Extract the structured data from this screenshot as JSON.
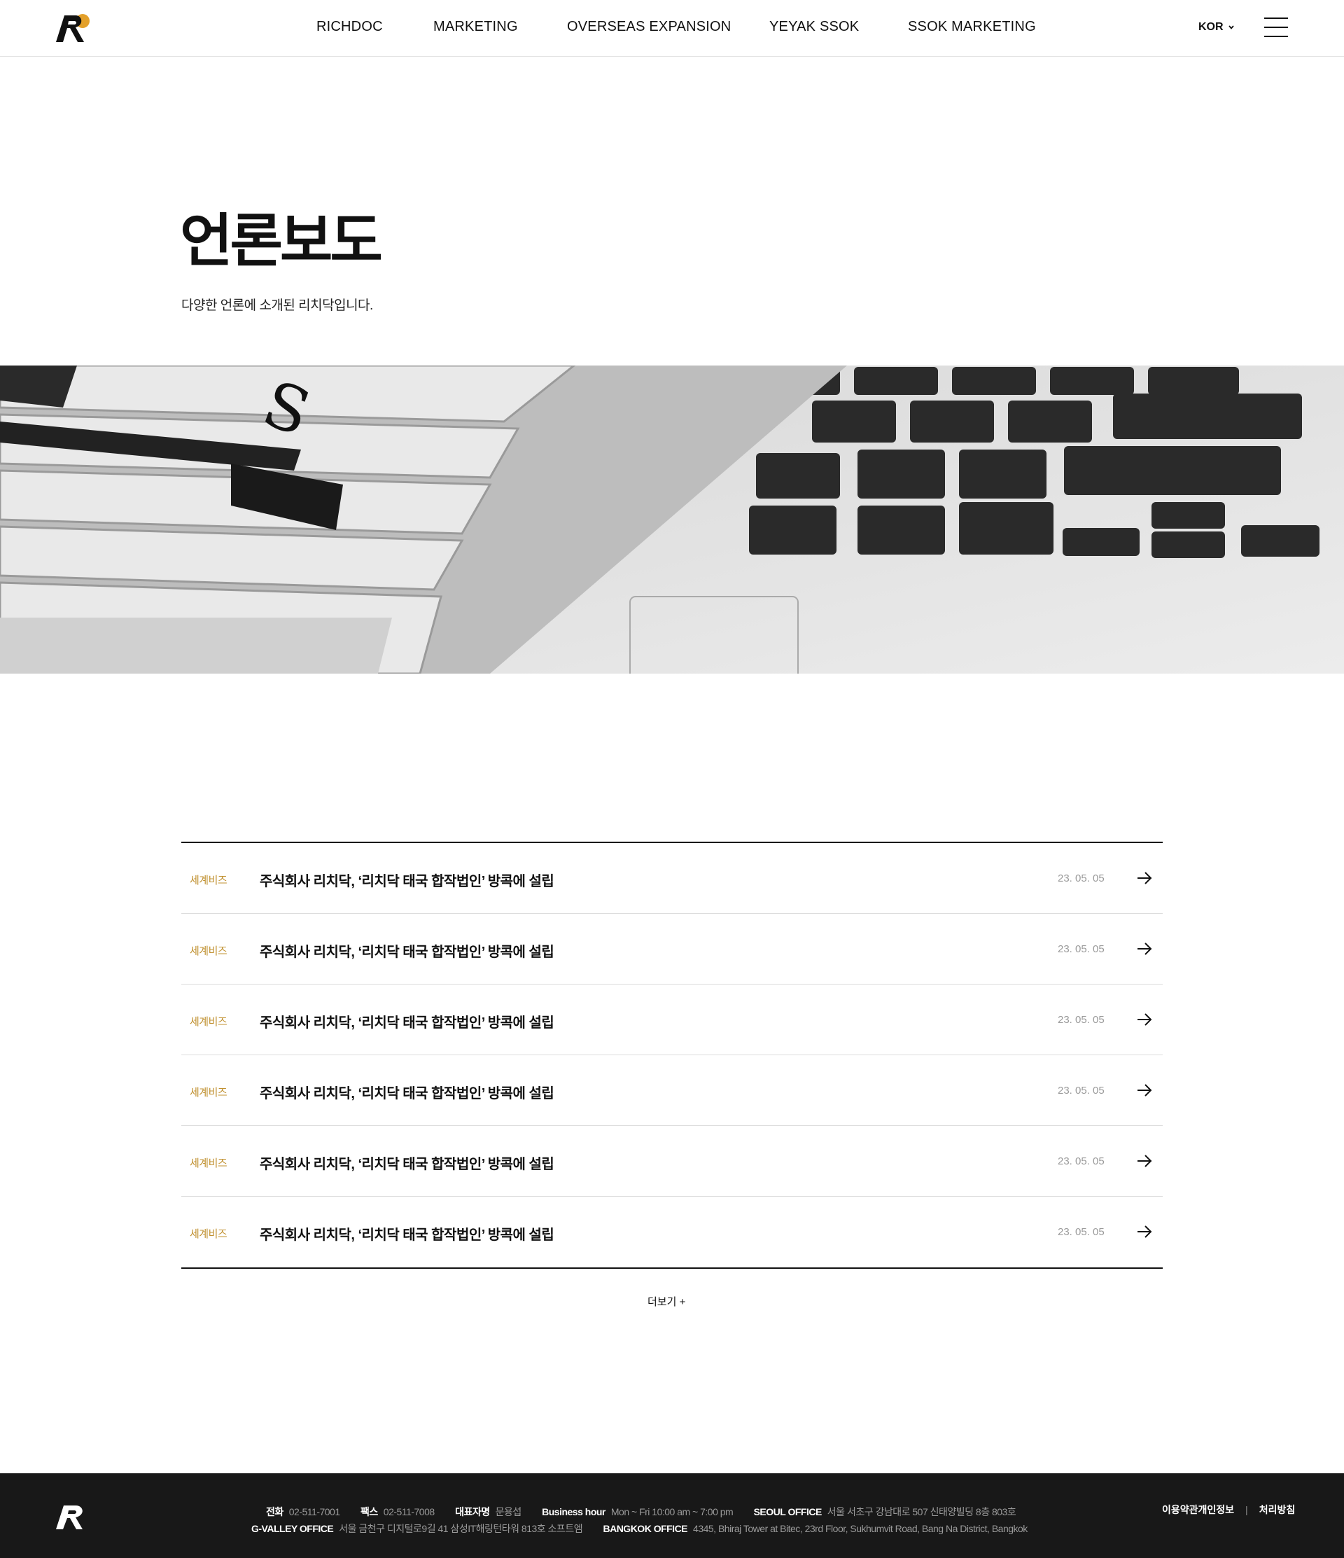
{
  "header": {
    "nav": [
      "RICHDOC",
      "MARKETING",
      "OVERSEAS EXPANSION",
      "YEYAK SSOK",
      "SSOK MARKETING"
    ],
    "lang": "KOR",
    "logo_icon": "richdoc-logo-icon",
    "menu_icon": "hamburger-icon"
  },
  "hero": {
    "title": "언론보도",
    "subtitle": "다양한 언론에 소개된 리치닥입니다."
  },
  "news": [
    {
      "source": "세계비즈",
      "title": "주식회사 리치닥, ‘리치닥 태국 합작법인’ 방콕에 설립",
      "date": "23. 05. 05"
    },
    {
      "source": "세계비즈",
      "title": "주식회사 리치닥, ‘리치닥 태국 합작법인’ 방콕에 설립",
      "date": "23. 05. 05"
    },
    {
      "source": "세계비즈",
      "title": "주식회사 리치닥, ‘리치닥 태국 합작법인’ 방콕에 설립",
      "date": "23. 05. 05"
    },
    {
      "source": "세계비즈",
      "title": "주식회사 리치닥, ‘리치닥 태국 합작법인’ 방콕에 설립",
      "date": "23. 05. 05"
    },
    {
      "source": "세계비즈",
      "title": "주식회사 리치닥, ‘리치닥 태국 합작법인’ 방콕에 설립",
      "date": "23. 05. 05"
    },
    {
      "source": "세계비즈",
      "title": "주식회사 리치닥, ‘리치닥 태국 합작법인’ 방콕에 설립",
      "date": "23. 05. 05"
    }
  ],
  "more_label": "더보기 +",
  "footer": {
    "phone_label": "전화",
    "phone": "02-511-7001",
    "fax_label": "팩스",
    "fax": "02-511-7008",
    "ceo_label": "대표자명",
    "ceo": "문용섭",
    "hours_label": "Business hour",
    "hours": "Mon ~ Fri 10:00 am ~ 7:00 pm",
    "seoul_label": "SEOUL OFFICE",
    "seoul": "서울 서초구 강남대로 507 신태양빌딩 8층 803호",
    "gvalley_label": "G-VALLEY OFFICE",
    "gvalley": "서울 금천구 디지털로9길 41 삼성IT해링턴타워 813호 소프트엠",
    "bangkok_label": "BANGKOK OFFICE",
    "bangkok": "4345, Bhiraj Tower at Bitec, 23rd Floor, Sukhumvit Road, Bang Na District, Bangkok",
    "terms": "이용약관개인정보",
    "policy": "처리방침"
  },
  "colors": {
    "accent": "#c0902f",
    "footer_bg": "#181818",
    "logo_orange": "#e3a02a"
  }
}
